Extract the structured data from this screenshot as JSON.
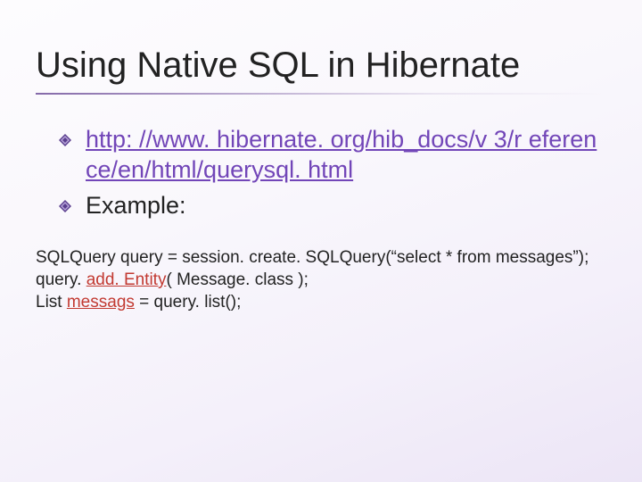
{
  "slide": {
    "title": "Using Native SQL in Hibernate",
    "bullets": [
      {
        "kind": "link",
        "text": "http: //www. hibernate. org/hib_docs/v 3/r eference/en/html/querysql. html"
      },
      {
        "kind": "text",
        "text": "Example:"
      }
    ],
    "code": {
      "line1_a": "SQLQuery query = session. create. SQLQuery(“select * from messages”);",
      "line2_a": "query. ",
      "line2_b": "add. Entity",
      "line2_c": "( Message. class );",
      "line3_a": "List ",
      "line3_b": "messags",
      "line3_c": " = query. list();"
    }
  },
  "colors": {
    "accent": "#7246b8",
    "error": "#c23a32"
  }
}
